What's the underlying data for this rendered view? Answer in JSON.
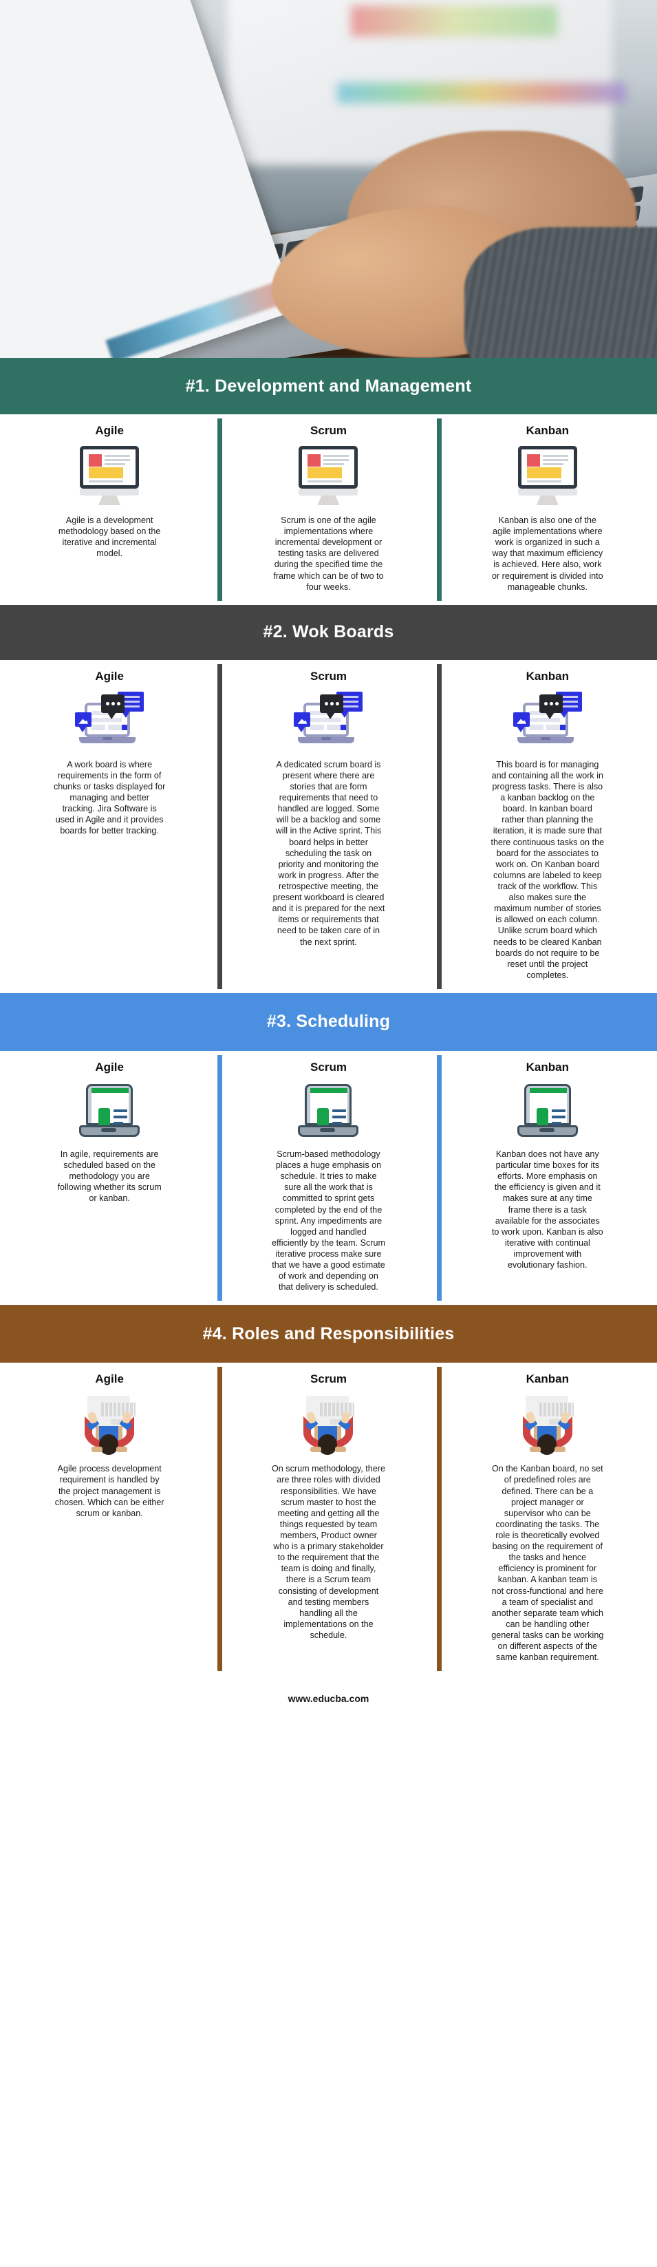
{
  "page": {
    "footer_url": "www.educba.com",
    "colors": {
      "section1": "#2f7263",
      "section2": "#444444",
      "section3": "#4a8fe0",
      "section4": "#8a5420",
      "text": "#1a1a1a"
    }
  },
  "hero": {
    "alt": "person typing on a laptop keyboard at a desk with a second monitor in the background"
  },
  "sections": [
    {
      "id": "development-and-management",
      "band_label": "#1. Development and Management",
      "band_color": "#2f7263",
      "icon": "desktop-monitor-icon",
      "columns": [
        {
          "title": "Agile",
          "text": "Agile is a development methodology based on the iterative and incremental model."
        },
        {
          "title": "Scrum",
          "text": "Scrum is one of the agile implementations where incremental development or testing tasks are delivered during the specified time the frame which can be of two to four weeks."
        },
        {
          "title": "Kanban",
          "text": "Kanban is also one of the agile implementations where work is organized in such a way that maximum efficiency is achieved. Here also, work or requirement is divided into manageable chunks."
        }
      ]
    },
    {
      "id": "wok-boards",
      "band_label": "#2. Wok Boards",
      "band_color": "#444444",
      "icon": "laptop-chat-board-icon",
      "columns": [
        {
          "title": "Agile",
          "text": "A work board is where requirements in the form of chunks or tasks displayed for managing and better tracking. Jira Software is used in Agile and it provides boards for better tracking."
        },
        {
          "title": "Scrum",
          "text": "A dedicated scrum board is present where there are stories that are form requirements that need to handled are logged. Some will be a backlog and some will in the Active sprint. This board helps in better scheduling the task on priority and monitoring the work in progress. After the retrospective meeting, the present workboard is cleared and it is prepared for the next items or requirements that need to be taken care of in the next sprint."
        },
        {
          "title": "Kanban",
          "text": "This board is for managing and containing all the work in progress tasks. There is also a kanban backlog on the board. In kanban board rather than planning the iteration, it is made sure that there continuous tasks on the board for the associates to work on. On Kanban board columns are labeled to keep track of the workflow. This also makes sure the maximum number of stories is allowed on each column. Unlike scrum board which needs to be cleared Kanban boards do not require to be reset until the project completes."
        }
      ]
    },
    {
      "id": "scheduling",
      "band_label": "#3. Scheduling",
      "band_color": "#4a8fe0",
      "icon": "laptop-schedule-icon",
      "columns": [
        {
          "title": "Agile",
          "text": "In agile, requirements are scheduled based on the methodology you are following whether its scrum or kanban."
        },
        {
          "title": "Scrum",
          "text": "Scrum-based methodology places a huge emphasis on schedule. It tries to make sure all the work that is committed to sprint gets completed by the end of the sprint. Any impediments are logged and handled efficiently by the team. Scrum iterative process make sure that we have a good estimate of work and depending on that delivery is scheduled."
        },
        {
          "title": "Kanban",
          "text": "Kanban does not have any particular time boxes for its efforts. More emphasis on the efficiency is given and it makes sure at any time frame there is a task available for the associates to work upon. Kanban is also iterative with continual improvement with evolutionary fashion."
        }
      ]
    },
    {
      "id": "roles-and-responsibilities",
      "band_label": "#4. Roles and Responsibilities",
      "band_color": "#8a5420",
      "icon": "person-at-laptop-icon",
      "columns": [
        {
          "title": "Agile",
          "text": "Agile process development requirement is handled by the project management is chosen. Which can be either scrum or kanban."
        },
        {
          "title": "Scrum",
          "text": "On scrum methodology, there are three roles with divided responsibilities. We have scrum master to host the meeting and getting all the things requested by team members, Product owner who is a primary stakeholder to the requirement that the team is doing and finally, there is a Scrum team consisting of development and testing members handling all the implementations on the schedule."
        },
        {
          "title": "Kanban",
          "text": "On the Kanban board, no set of predefined roles are defined. There can be a project manager or supervisor who can be coordinating the tasks. The role is theoretically evolved basing on the requirement of the tasks and hence efficiency is prominent for kanban. A kanban team is not cross-functional and here a team of specialist and another separate team which can be handling other general tasks can be working on different aspects of the same kanban requirement."
        }
      ]
    }
  ]
}
